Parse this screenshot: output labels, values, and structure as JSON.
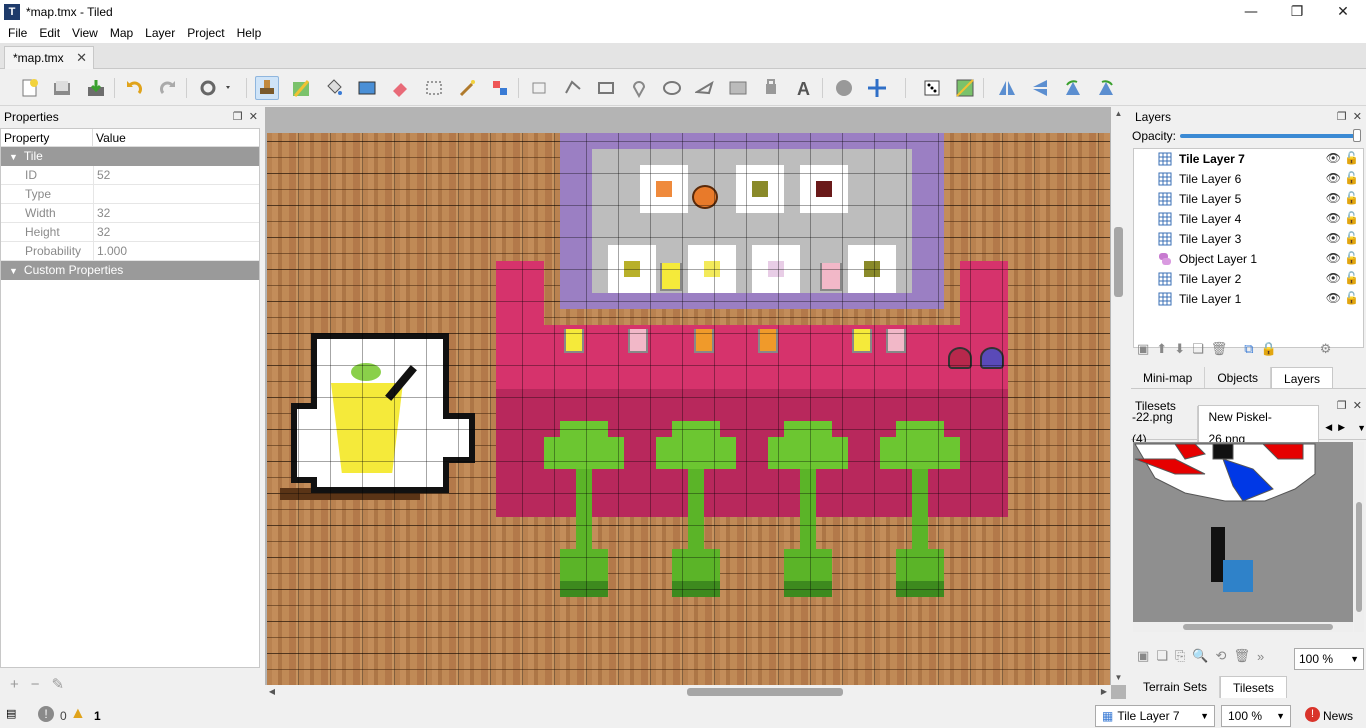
{
  "window": {
    "title": "*map.tmx - Tiled",
    "minimize": "—",
    "maximize": "❐",
    "close": "✕"
  },
  "menu": [
    "File",
    "Edit",
    "View",
    "Map",
    "Layer",
    "Project",
    "Help"
  ],
  "document_tab": {
    "label": "*map.tmx",
    "close": "✕"
  },
  "toolbar": {
    "icons": [
      "new-map-icon",
      "open-icon",
      "save-icon",
      "undo-icon",
      "redo-icon",
      "commands-icon",
      "stamp-brush-icon",
      "terrain-brush-icon",
      "bucket-fill-icon",
      "shape-fill-icon",
      "eraser-icon",
      "rectangular-select-icon",
      "magic-wand-icon",
      "select-same-tile-icon",
      "select-objects-icon",
      "edit-polygons-icon",
      "insert-rectangle-icon",
      "insert-point-icon",
      "insert-ellipse-icon",
      "insert-polygon-icon",
      "insert-tile-icon",
      "insert-template-icon",
      "insert-text-icon",
      "world-tool-icon",
      "move-icon",
      "random-mode-icon",
      "wang-fill-icon",
      "flip-horizontal-icon",
      "flip-vertical-icon",
      "rotate-left-icon",
      "rotate-right-icon"
    ],
    "active": "stamp-brush-icon"
  },
  "properties": {
    "title": "Properties",
    "header": {
      "property": "Property",
      "value": "Value"
    },
    "group_tile": "Tile",
    "rows": [
      {
        "name": "ID",
        "value": "52"
      },
      {
        "name": "Type",
        "value": ""
      },
      {
        "name": "Width",
        "value": "32"
      },
      {
        "name": "Height",
        "value": "32"
      },
      {
        "name": "Probability",
        "value": "1.000"
      }
    ],
    "group_custom": "Custom Properties"
  },
  "layers": {
    "title": "Layers",
    "opacity_label": "Opacity:",
    "opacity": 1.0,
    "items": [
      {
        "name": "Tile Layer 7",
        "type": "tile",
        "selected": true
      },
      {
        "name": "Tile Layer 6",
        "type": "tile"
      },
      {
        "name": "Tile Layer 5",
        "type": "tile"
      },
      {
        "name": "Tile Layer 4",
        "type": "tile"
      },
      {
        "name": "Tile Layer 3",
        "type": "tile"
      },
      {
        "name": "Object Layer 1",
        "type": "object"
      },
      {
        "name": "Tile Layer 2",
        "type": "tile"
      },
      {
        "name": "Tile Layer 1",
        "type": "tile"
      }
    ],
    "tabs": [
      "Mini-map",
      "Objects",
      "Layers"
    ],
    "active_tab": "Layers"
  },
  "tilesets": {
    "title": "Tilesets",
    "tabs": [
      "-22.png (4)",
      "New Piskel-26.png"
    ],
    "zoom": "100 %",
    "bottom_tabs": [
      "Terrain Sets",
      "Tilesets"
    ],
    "active_bottom_tab": "Tilesets"
  },
  "status": {
    "errors": "0",
    "warnings": "1",
    "current_layer": "Tile Layer 7",
    "zoom": "100 %",
    "news": "News"
  },
  "colors": {
    "accent": "#3b8ad4",
    "carpet": "#d6336c",
    "carpet_dark": "#b8285c",
    "frame": "#9b7fc3",
    "floor": "#b98250",
    "plant": "#6cc631"
  }
}
